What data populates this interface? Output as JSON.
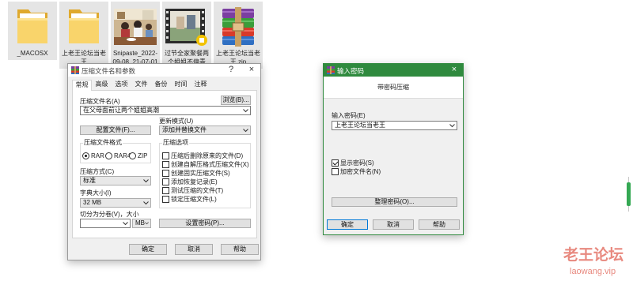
{
  "colors": {
    "accent": "#2f8a3e",
    "watermark": "#e8897f",
    "scroll_thumb": "#34a853",
    "default_button_border": "#0078d7"
  },
  "desktop": {
    "icons": [
      {
        "icon": "folder-icon",
        "lines": [
          "_MACOSX"
        ]
      },
      {
        "icon": "folder-icon",
        "lines": [
          "上老王论坛当老",
          "王"
        ]
      },
      {
        "icon": "image-thumbnail",
        "lines": [
          "Snipaste_2022-",
          "09-08_21-07-01"
        ]
      },
      {
        "icon": "video-thumbnail",
        "lines": [
          "过节全家聚餐两",
          "个姐姐不停青"
        ]
      },
      {
        "icon": "winrar-archive-icon",
        "lines": [
          "上老王论坛当老",
          "王.zip"
        ]
      }
    ]
  },
  "archive_dialog": {
    "title": "压缩文件名和参数",
    "help_glyph": "?",
    "close_glyph": "×",
    "tabs": [
      "常规",
      "高级",
      "选项",
      "文件",
      "备份",
      "时间",
      "注释"
    ],
    "archive_name_label": "压缩文件名(A)",
    "browse_button": "浏览(B)...",
    "archive_name_value": "在父母面前让两个姐姐高潮",
    "update_mode_label": "更新模式(U)",
    "update_mode_value": "添加并替换文件",
    "profiles_button": "配置文件(F)...",
    "format_group_label": "压缩文件格式",
    "formats": [
      {
        "label": "RAR",
        "selected": true
      },
      {
        "label": "RAR4",
        "selected": false
      },
      {
        "label": "ZIP",
        "selected": false
      }
    ],
    "options_group_label": "压缩选项",
    "options": [
      {
        "label": "压缩后删除原来的文件(D)",
        "checked": false
      },
      {
        "label": "创建自解压格式压缩文件(X)",
        "checked": false
      },
      {
        "label": "创建固实压缩文件(S)",
        "checked": false
      },
      {
        "label": "添加恢复记录(E)",
        "checked": false
      },
      {
        "label": "测试压缩的文件(T)",
        "checked": false
      },
      {
        "label": "锁定压缩文件(L)",
        "checked": false
      }
    ],
    "method_label": "压缩方式(C)",
    "method_value": "标准",
    "dict_label": "字典大小(I)",
    "dict_value": "32 MB",
    "split_label": "切分为分卷(V)，大小",
    "split_value": "",
    "split_unit": "MB",
    "password_button": "设置密码(P)...",
    "ok_button": "确定",
    "cancel_button": "取消",
    "help_button": "帮助"
  },
  "password_dialog": {
    "title": "输入密码",
    "close_glyph": "×",
    "header": "带密码压缩",
    "password_label": "输入密码(E)",
    "password_value": "上老王论坛当老王",
    "show_password": {
      "label": "显示密码(S)",
      "checked": true
    },
    "encrypt_names": {
      "label": "加密文件名(N)",
      "checked": false
    },
    "organize_button": "整理密码(O)...",
    "ok_button": "确定",
    "cancel_button": "取消",
    "help_button": "帮助"
  },
  "watermark": {
    "title": "老王论坛",
    "url": "laowang.vip"
  }
}
